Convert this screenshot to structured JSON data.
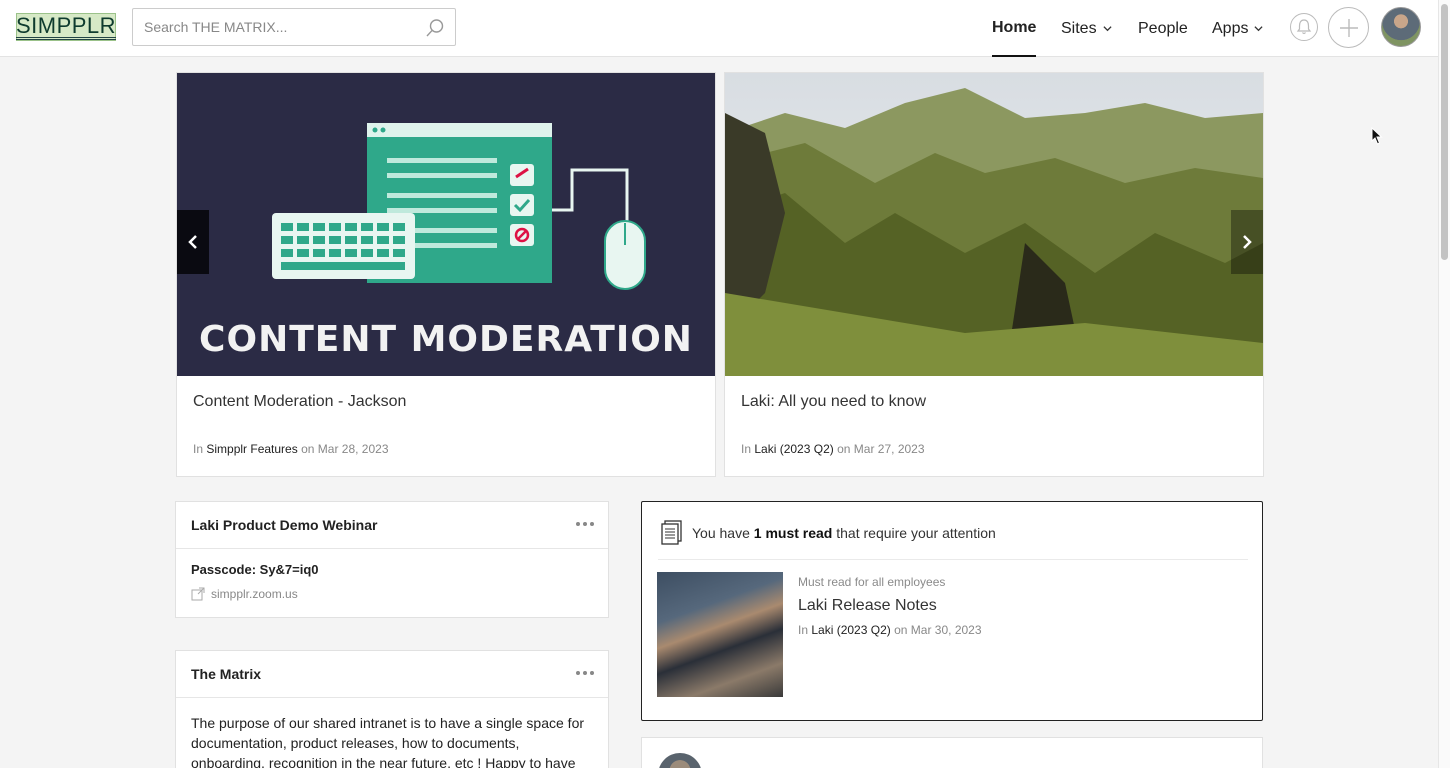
{
  "logo": {
    "text": "SIMPPLR"
  },
  "search": {
    "placeholder": "Search THE MATRIX..."
  },
  "nav": {
    "home": "Home",
    "sites": "Sites",
    "people": "People",
    "apps": "Apps"
  },
  "carousel": {
    "items": [
      {
        "image_text": "CONTENT MODERATION",
        "title": "Content Moderation - Jackson",
        "in_label": "In",
        "site": "Simpplr Features",
        "on_label": "on",
        "date": "Mar 28, 2023"
      },
      {
        "title": "Laki: All you need to know",
        "in_label": "In",
        "site": "Laki (2023 Q2)",
        "on_label": "on",
        "date": "Mar 27, 2023"
      }
    ]
  },
  "webinar": {
    "title": "Laki Product Demo Webinar",
    "passcode": "Passcode: Sy&7=iq0",
    "link": "simpplr.zoom.us"
  },
  "matrix": {
    "title": "The Matrix",
    "body": "The purpose of our shared intranet is to have a single space for documentation, product releases, how to documents, onboarding, recognition in the near future, etc ! Happy to have"
  },
  "must_read": {
    "prefix": "You have",
    "count_text": "1 must read",
    "suffix": "that require your attention",
    "kicker": "Must read for all employees",
    "title": "Laki Release Notes",
    "in_label": "In",
    "site": "Laki (2023 Q2)",
    "on_label": "on",
    "date": "Mar 30, 2023"
  },
  "icons": [
    "search-icon",
    "chevron-down-icon",
    "bell-icon",
    "plus-icon",
    "chevron-left-icon",
    "chevron-right-icon",
    "more-icon",
    "external-link-icon",
    "documents-icon"
  ],
  "colors": {
    "accent": "#222222",
    "teal_art": "#2fa88a",
    "link_text": "#222222",
    "muted": "#888888"
  }
}
